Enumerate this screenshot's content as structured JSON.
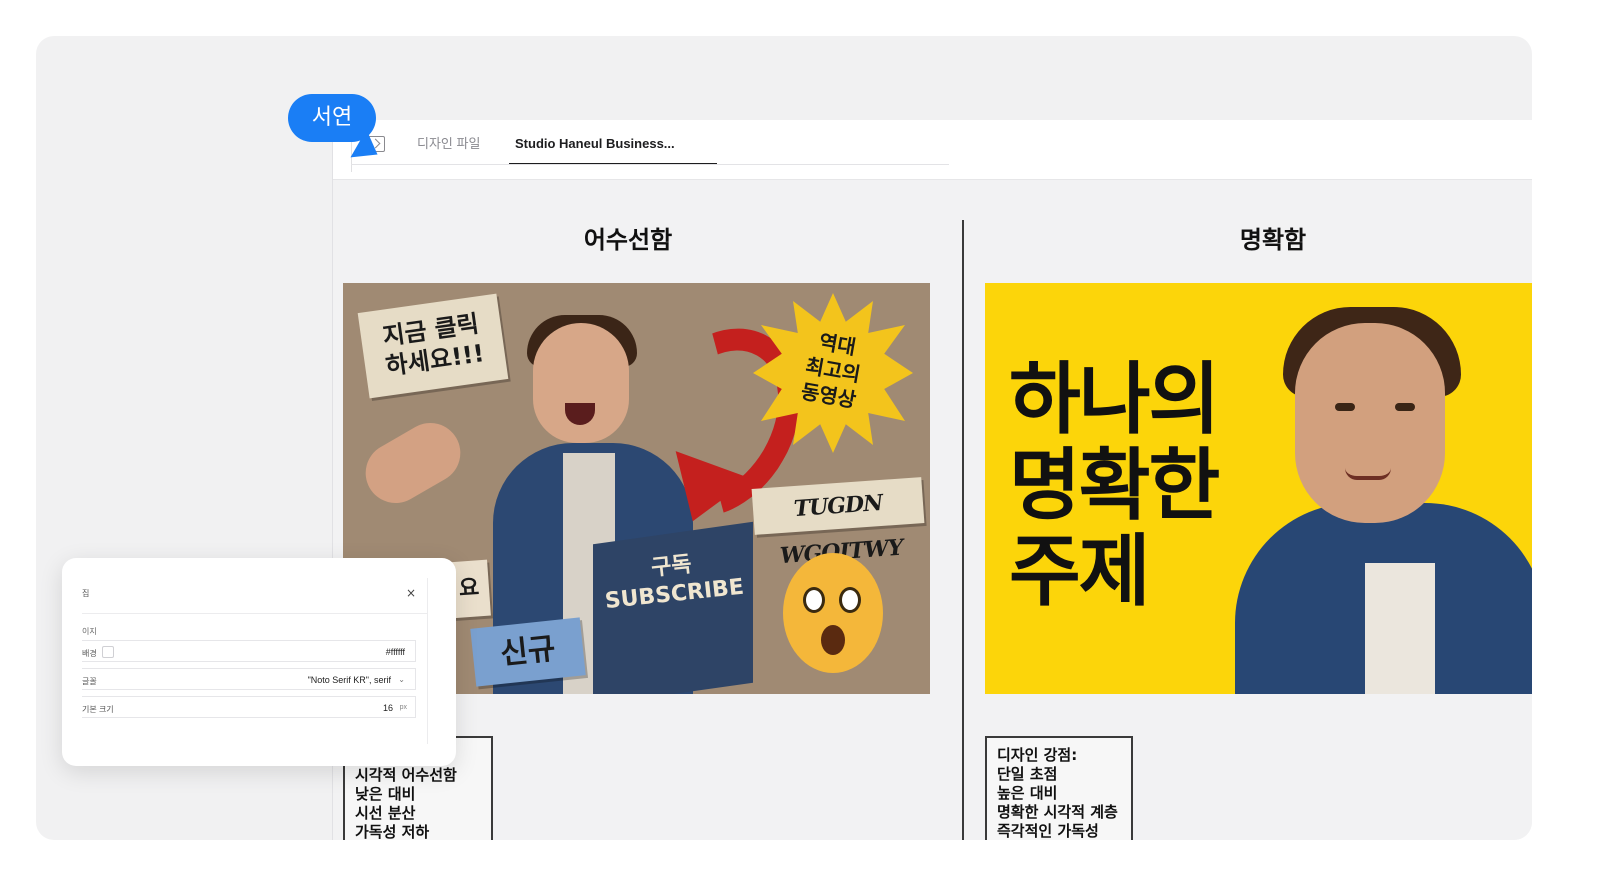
{
  "cursor": {
    "user_name": "서연"
  },
  "tabs": {
    "design_file": "디자인 파일",
    "active": "Studio Haneul Business..."
  },
  "columns": {
    "left_title": "어수선함",
    "right_title": "명확함"
  },
  "thumbnail_left": {
    "sticker_click": "지금 클릭\n하세요!!!",
    "burst": "역대\n최고의\n동영상",
    "sticker_scribble": "TUGDN WGOITWY",
    "box_text": "구독\nSUBSCRIBE",
    "sticker_new": "신규",
    "sticker_partial": "요"
  },
  "thumbnail_right": {
    "headline": "하나의\n명확한\n주제"
  },
  "notes": {
    "left": [
      "시각적 어수선함",
      "낮은 대비",
      "시선 분산",
      "가독성 저하"
    ],
    "right": [
      "디자인 강점:",
      "단일 초점",
      "높은 대비",
      "명확한 시각적 계층",
      "즉각적인 가독성"
    ]
  },
  "panel": {
    "title": "집",
    "close": "×",
    "section": "이지",
    "background_label": "배경",
    "background_value": "#ffffff",
    "font_label": "글꼴",
    "font_value": "\"Noto Serif KR\", serif",
    "size_label": "기본 크기",
    "size_value": "16",
    "size_unit": "px"
  },
  "colors": {
    "accent": "#1a7ef5",
    "thumb_right_bg": "#fcd50a",
    "arrow": "#c4201e"
  }
}
